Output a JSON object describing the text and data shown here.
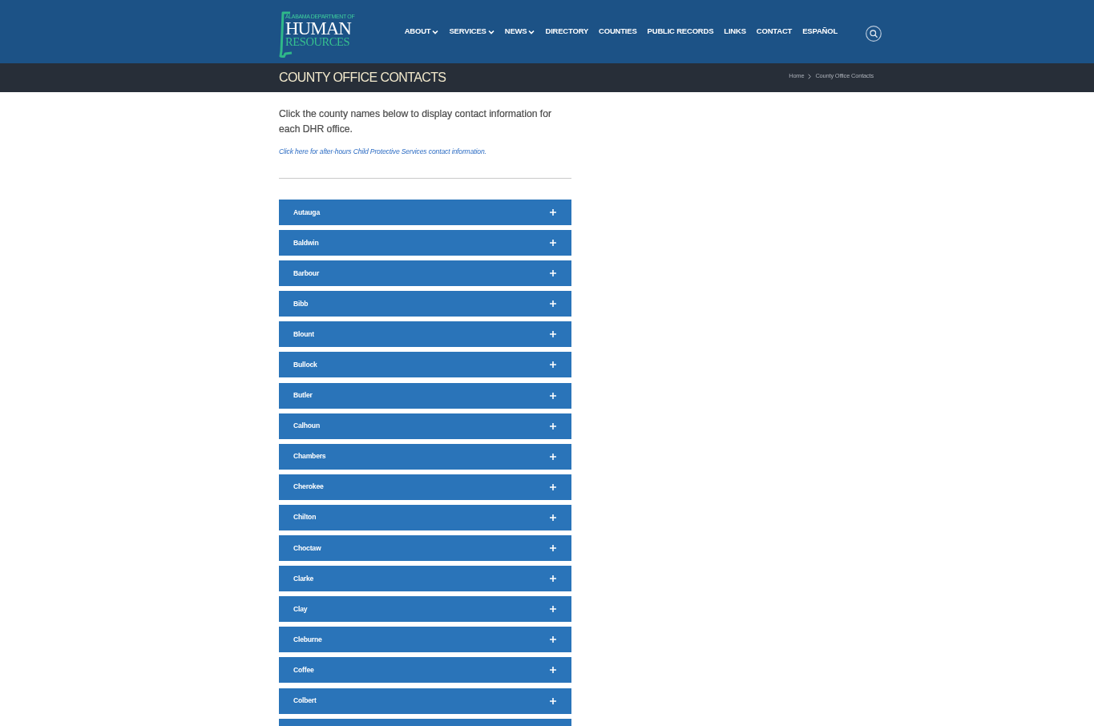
{
  "header": {
    "logo": {
      "line_1": "ALABAMA DEPARTMENT OF",
      "line_2": "HUMAN",
      "line_3": "RESOURCES"
    },
    "nav": [
      {
        "label": "ABOUT",
        "dropdown": true
      },
      {
        "label": "SERVICES",
        "dropdown": true
      },
      {
        "label": "NEWS",
        "dropdown": true
      },
      {
        "label": "DIRECTORY",
        "dropdown": false
      },
      {
        "label": "COUNTIES",
        "dropdown": false
      },
      {
        "label": "PUBLIC RECORDS",
        "dropdown": false
      },
      {
        "label": "LINKS",
        "dropdown": false
      },
      {
        "label": "CONTACT",
        "dropdown": false
      },
      {
        "label": "ESPAÑOL",
        "dropdown": false
      }
    ]
  },
  "title_bar": {
    "title": "COUNTY OFFICE CONTACTS",
    "breadcrumb": [
      "Home",
      "County Office Contacts"
    ]
  },
  "intro": "Click the county names below to display contact information for each DHR office.",
  "link": "Click here for after-hours Child Protective Services contact information.",
  "counties": [
    {
      "name": "Autauga",
      "expanded": false
    },
    {
      "name": "Baldwin",
      "expanded": false
    },
    {
      "name": "Barbour",
      "expanded": false
    },
    {
      "name": "Bibb",
      "expanded": false
    },
    {
      "name": "Blount",
      "expanded": false
    },
    {
      "name": "Bullock",
      "expanded": false
    },
    {
      "name": "Butler",
      "expanded": false
    },
    {
      "name": "Calhoun",
      "expanded": false
    },
    {
      "name": "Chambers",
      "expanded": false
    },
    {
      "name": "Cherokee",
      "expanded": false
    },
    {
      "name": "Chilton",
      "expanded": false
    },
    {
      "name": "Choctaw",
      "expanded": false
    },
    {
      "name": "Clarke",
      "expanded": false
    },
    {
      "name": "Clay",
      "expanded": false
    },
    {
      "name": "Cleburne",
      "expanded": false
    },
    {
      "name": "Coffee",
      "expanded": false
    },
    {
      "name": "Colbert",
      "expanded": false
    },
    {
      "expanded": false
    }
  ]
}
